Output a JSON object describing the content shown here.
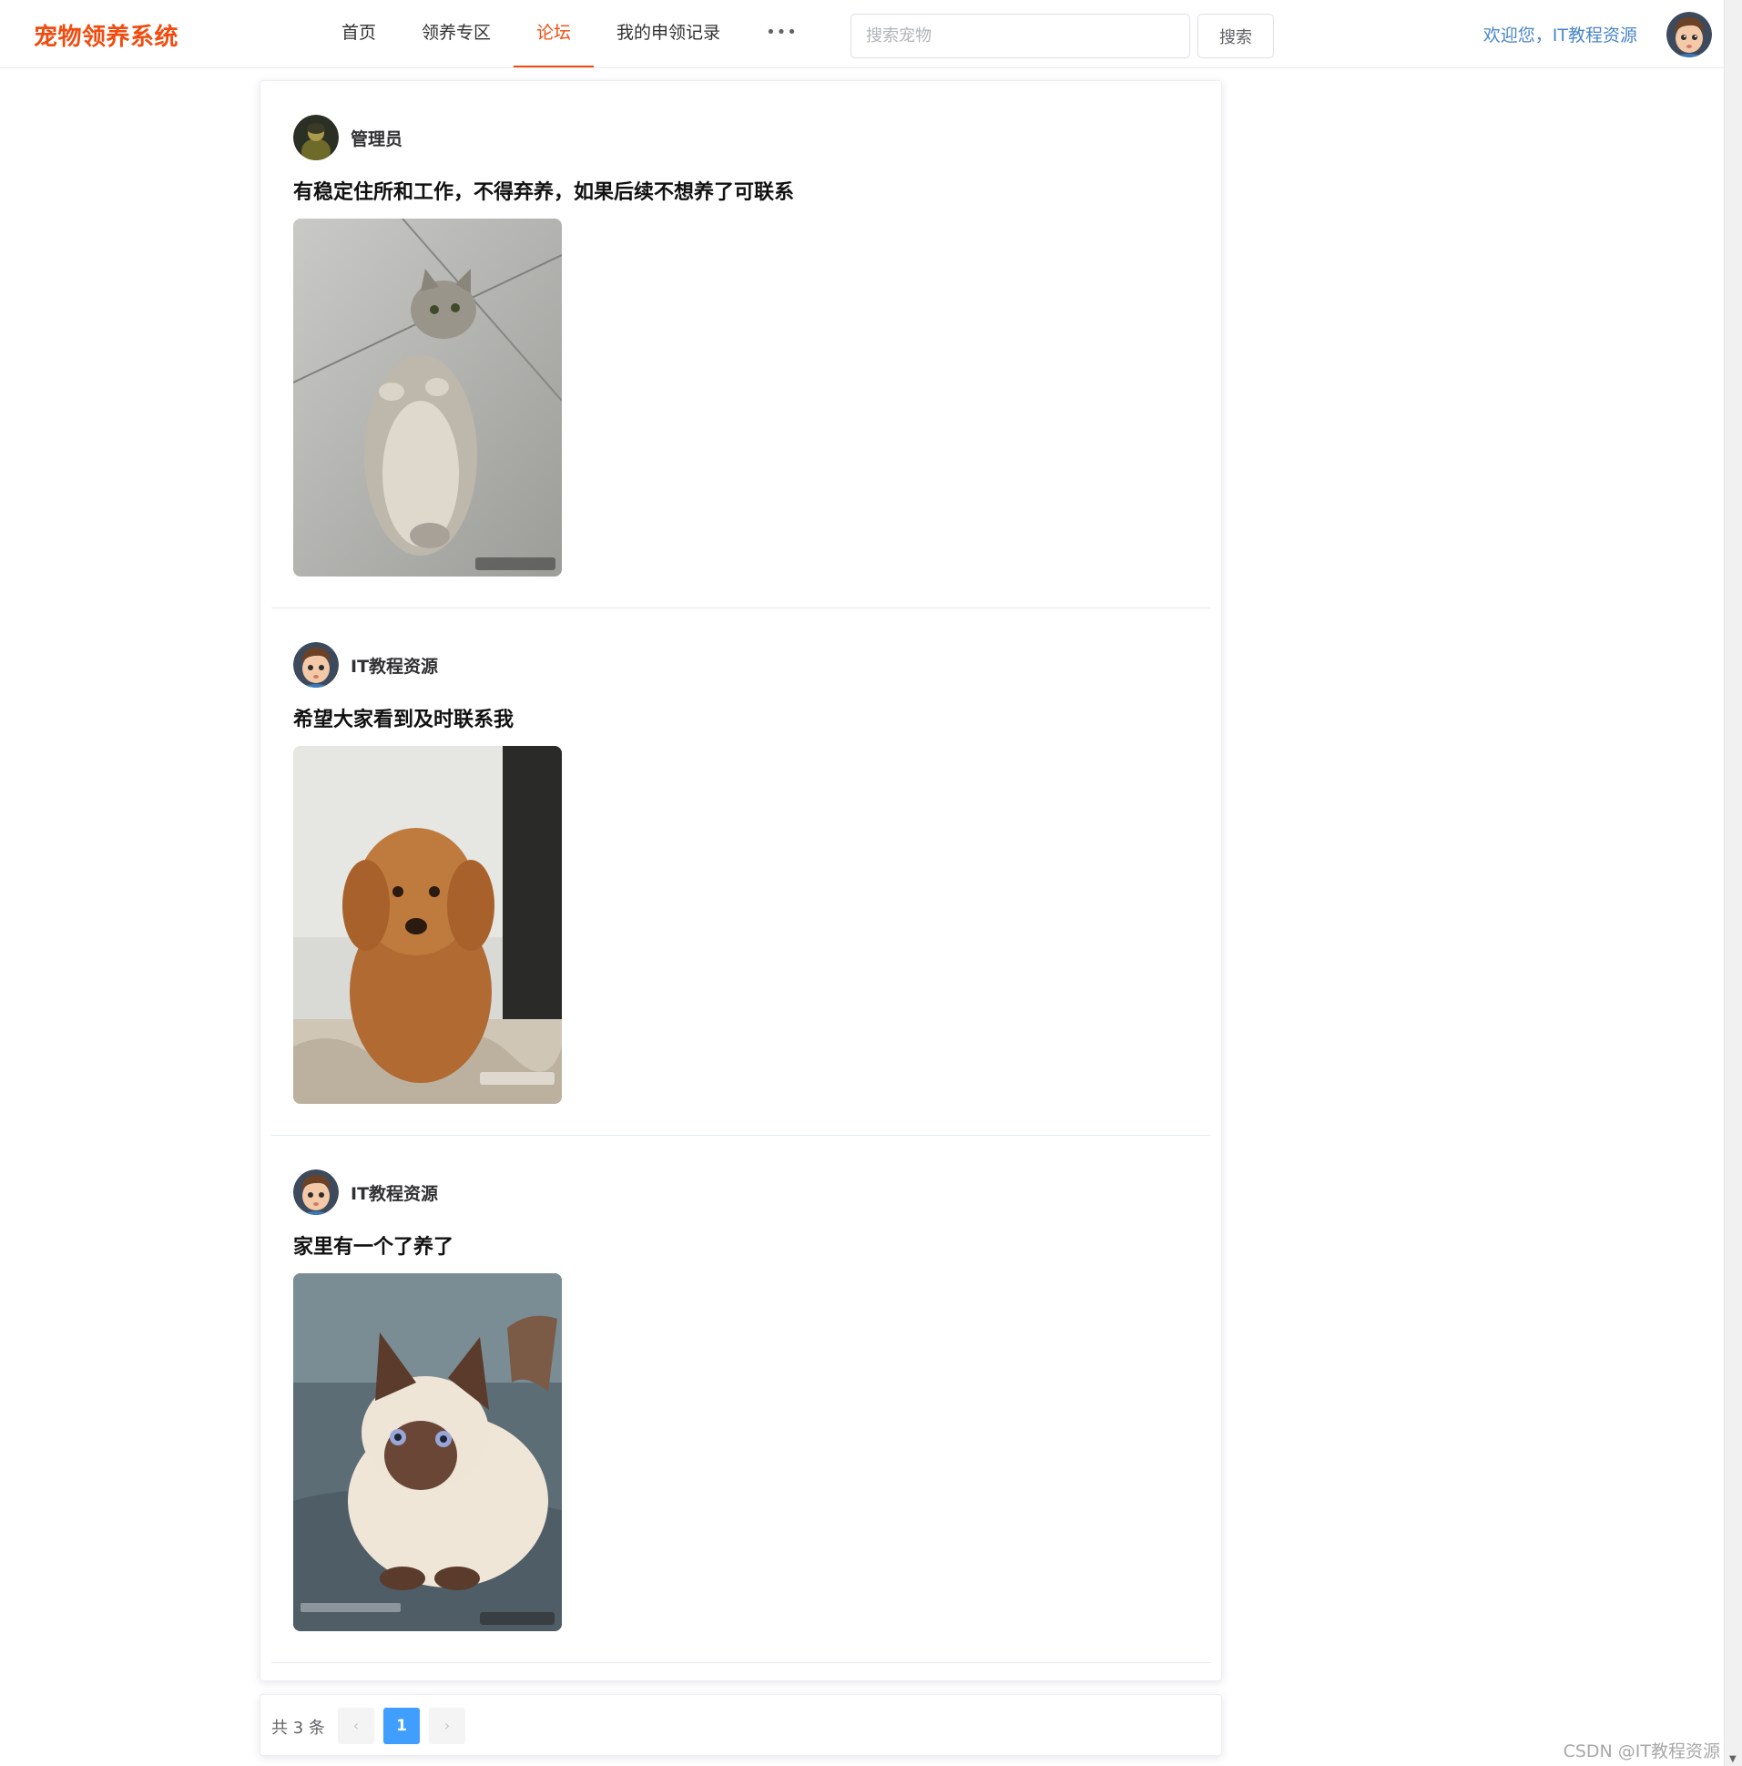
{
  "app": {
    "logo": "宠物领养系统"
  },
  "nav": {
    "items": [
      {
        "label": "首页"
      },
      {
        "label": "领养专区"
      },
      {
        "label": "论坛",
        "active": true
      },
      {
        "label": "我的申领记录"
      }
    ],
    "more_icon": "more-dots-icon",
    "more_label": "•••"
  },
  "search": {
    "placeholder": "搜索宠物",
    "value": "",
    "button_label": "搜索"
  },
  "user": {
    "welcome": "欢迎您，IT教程资源",
    "avatar_icon": "cartoon-boy-avatar"
  },
  "posts": [
    {
      "user": "管理员",
      "avatar_icon": "admin-avatar",
      "title": "有稳定住所和工作，不得弃养，如果后续不想养了可联系",
      "image_icon": "tabby-cat-photo"
    },
    {
      "user": "IT教程资源",
      "avatar_icon": "cartoon-boy-avatar",
      "title": "希望大家看到及时联系我",
      "image_icon": "poodle-dog-photo"
    },
    {
      "user": "IT教程资源",
      "avatar_icon": "cartoon-boy-avatar",
      "title": "家里有一个了养了",
      "image_icon": "siamese-cat-photo"
    }
  ],
  "pagination": {
    "total": "共 3 条",
    "prev_icon": "chevron-left-icon",
    "current_page": "1",
    "next_icon": "chevron-right-icon"
  },
  "watermark": "CSDN @IT教程资源",
  "colors": {
    "brand": "#f04c10",
    "link": "#4a86c8",
    "page_active": "#409eff"
  }
}
